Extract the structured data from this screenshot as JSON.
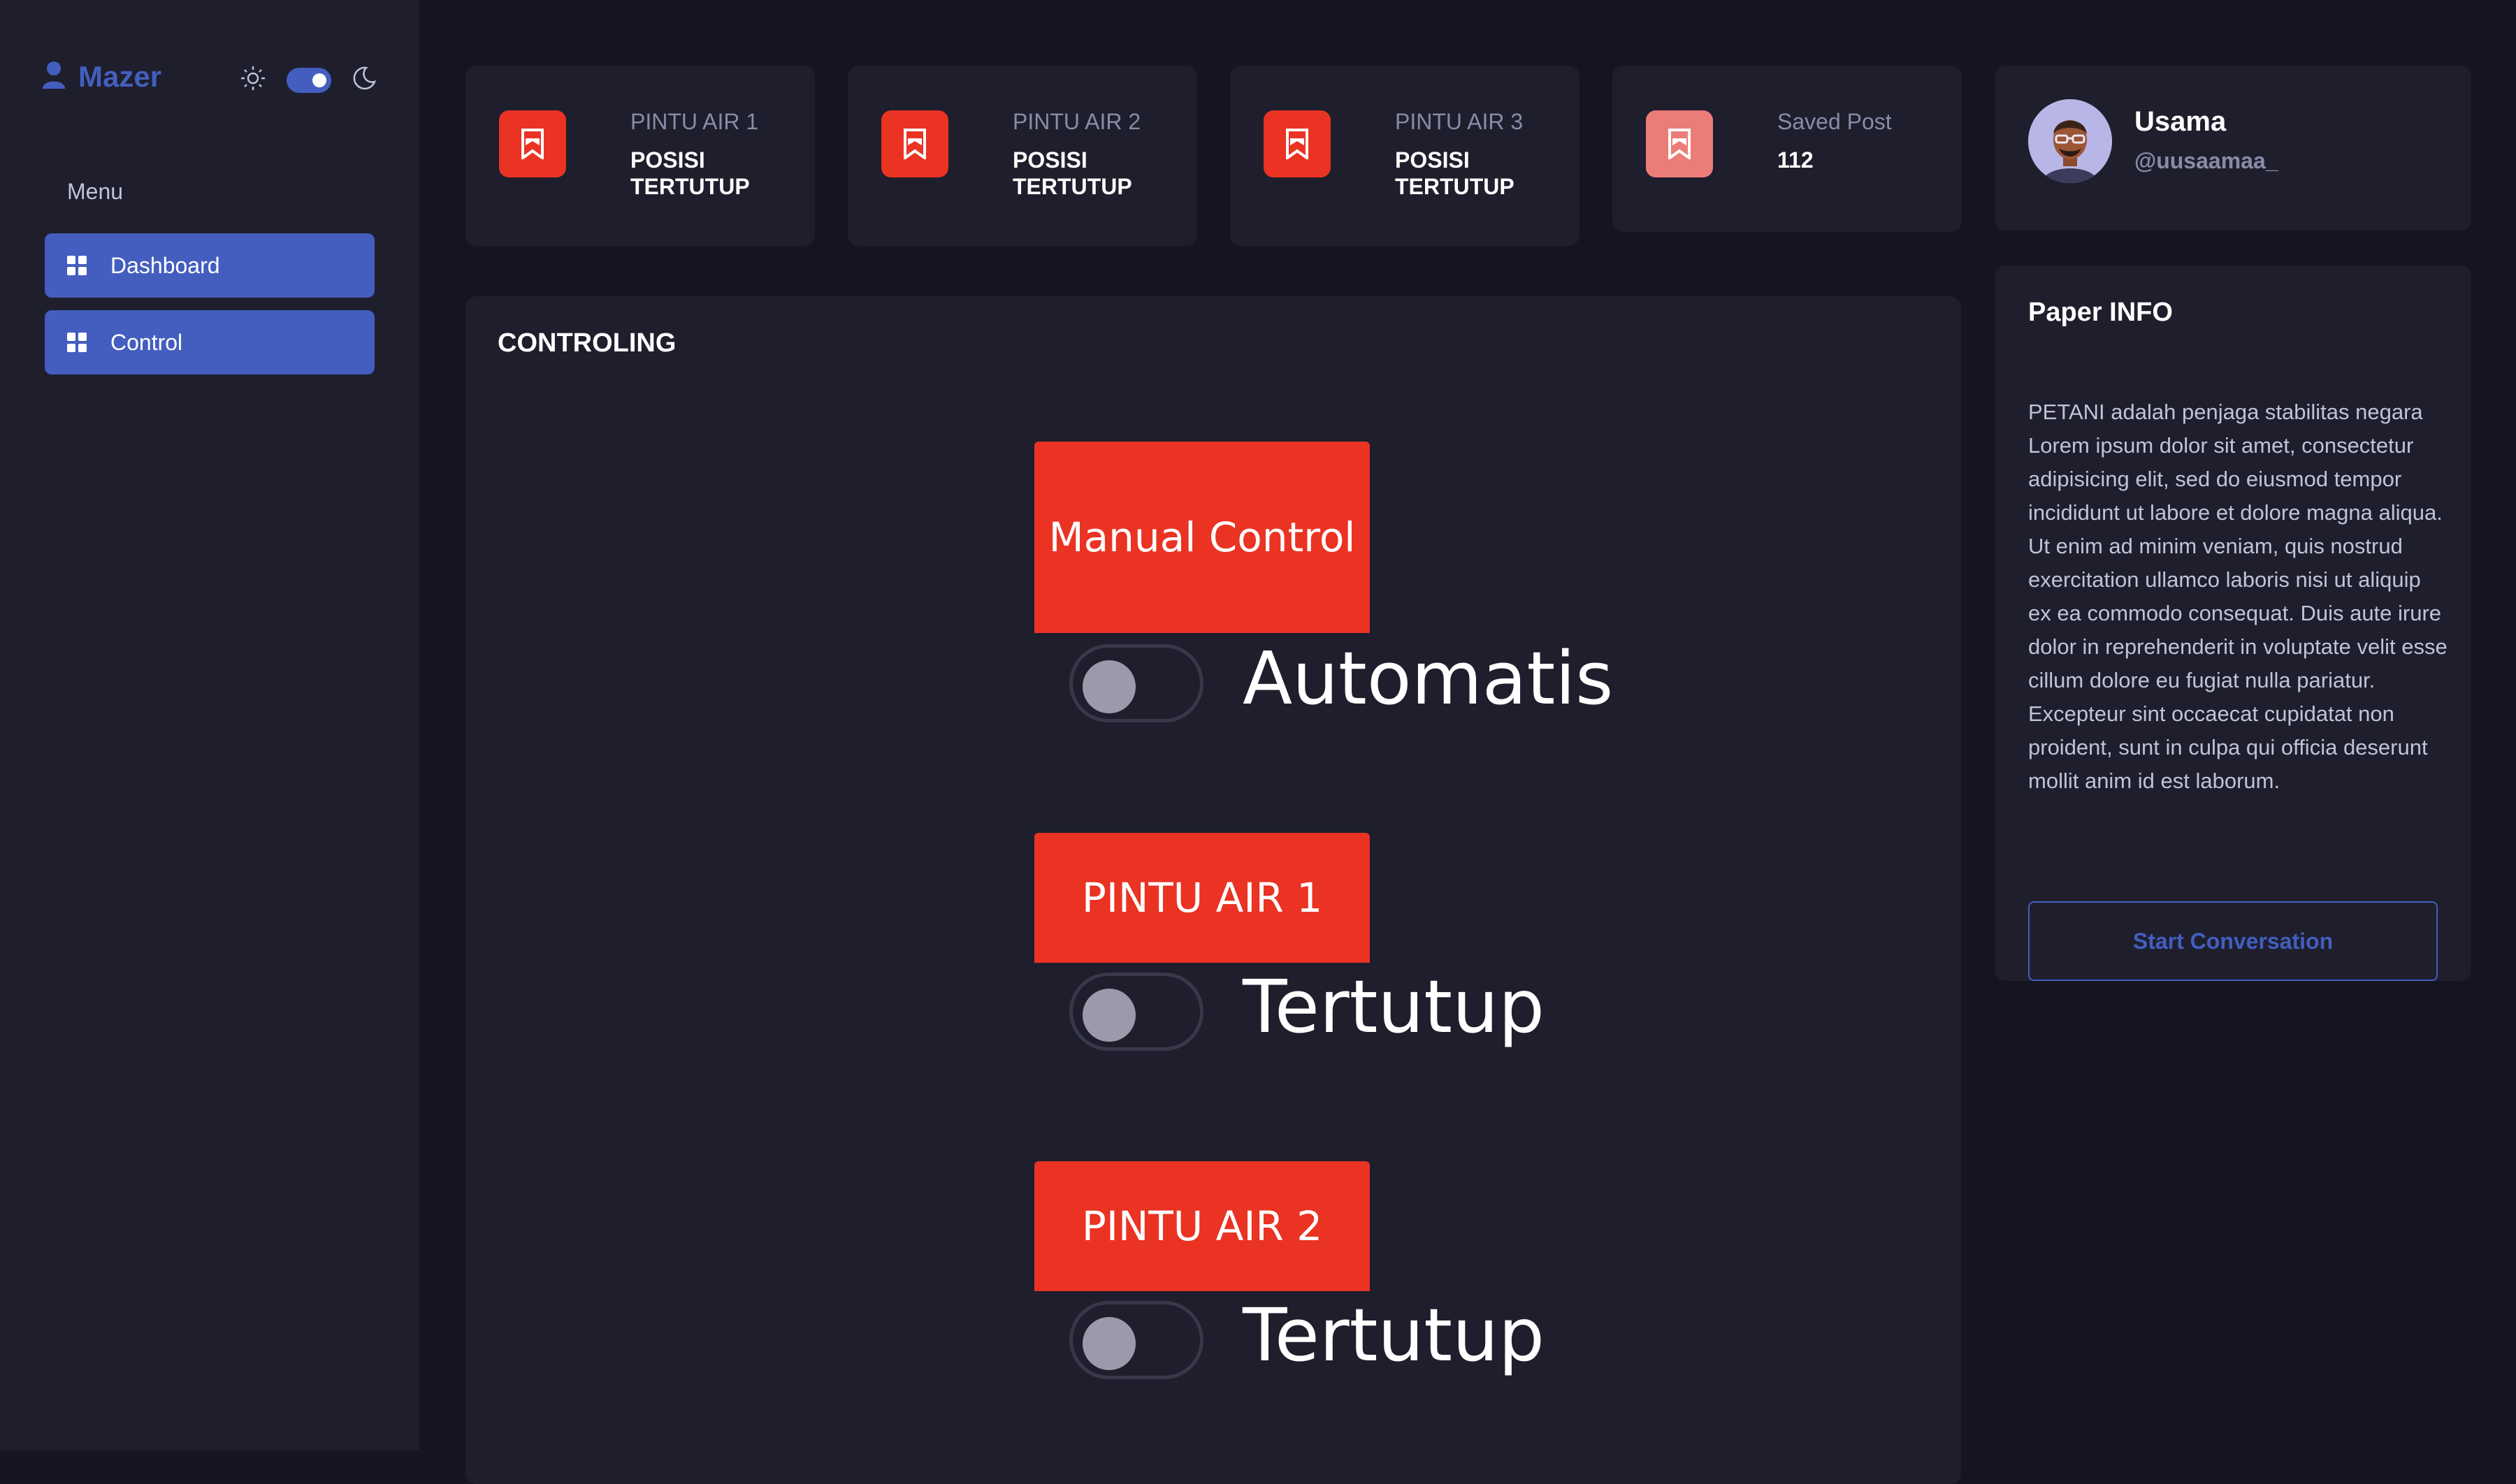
{
  "sidebar": {
    "brand": "Mazer",
    "menu_title": "Menu",
    "items": [
      {
        "label": "Dashboard"
      },
      {
        "label": "Control"
      }
    ]
  },
  "stats": [
    {
      "label": "PINTU AIR 1",
      "value": "POSISI TERTUTUP"
    },
    {
      "label": "PINTU AIR 2",
      "value": "POSISI TERTUTUP"
    },
    {
      "label": "PINTU AIR 3",
      "value": "POSISI TERTUTUP"
    },
    {
      "label": "Saved Post",
      "value": "112"
    }
  ],
  "profile": {
    "name": "Usama",
    "handle": "@uusaamaa_"
  },
  "paper": {
    "title": "Paper INFO",
    "text": "PETANI adalah penjaga stabilitas negara Lorem ipsum dolor sit amet, consectetur adipisicing elit, sed do eiusmod tempor incididunt ut labore et dolore magna aliqua. Ut enim ad minim veniam, quis nostrud exercitation ullamco laboris nisi ut aliquip ex ea commodo consequat. Duis aute irure dolor in reprehenderit in voluptate velit esse cillum dolore eu fugiat nulla pariatur. Excepteur sint occaecat cupidatat non proident, sunt in culpa qui officia deserunt mollit anim id est laborum.",
    "button": "Start Conversation"
  },
  "control": {
    "title": "CONTROLING",
    "groups": [
      {
        "button": "Manual Control",
        "toggle_label": "Automatis",
        "on": false
      },
      {
        "button": "PINTU AIR 1",
        "toggle_label": "Tertutup",
        "on": false
      },
      {
        "button": "PINTU AIR 2",
        "toggle_label": "Tertutup",
        "on": false
      }
    ]
  },
  "colors": {
    "background": "#151521",
    "panel": "#1e1e2d",
    "primary": "#435ebe",
    "danger": "#ea3323"
  },
  "icons": {
    "brand": "user-icon",
    "theme_light": "sun-icon",
    "theme_dark": "moon-icon",
    "nav": "grid-icon",
    "stat": "bookmark-icon"
  }
}
